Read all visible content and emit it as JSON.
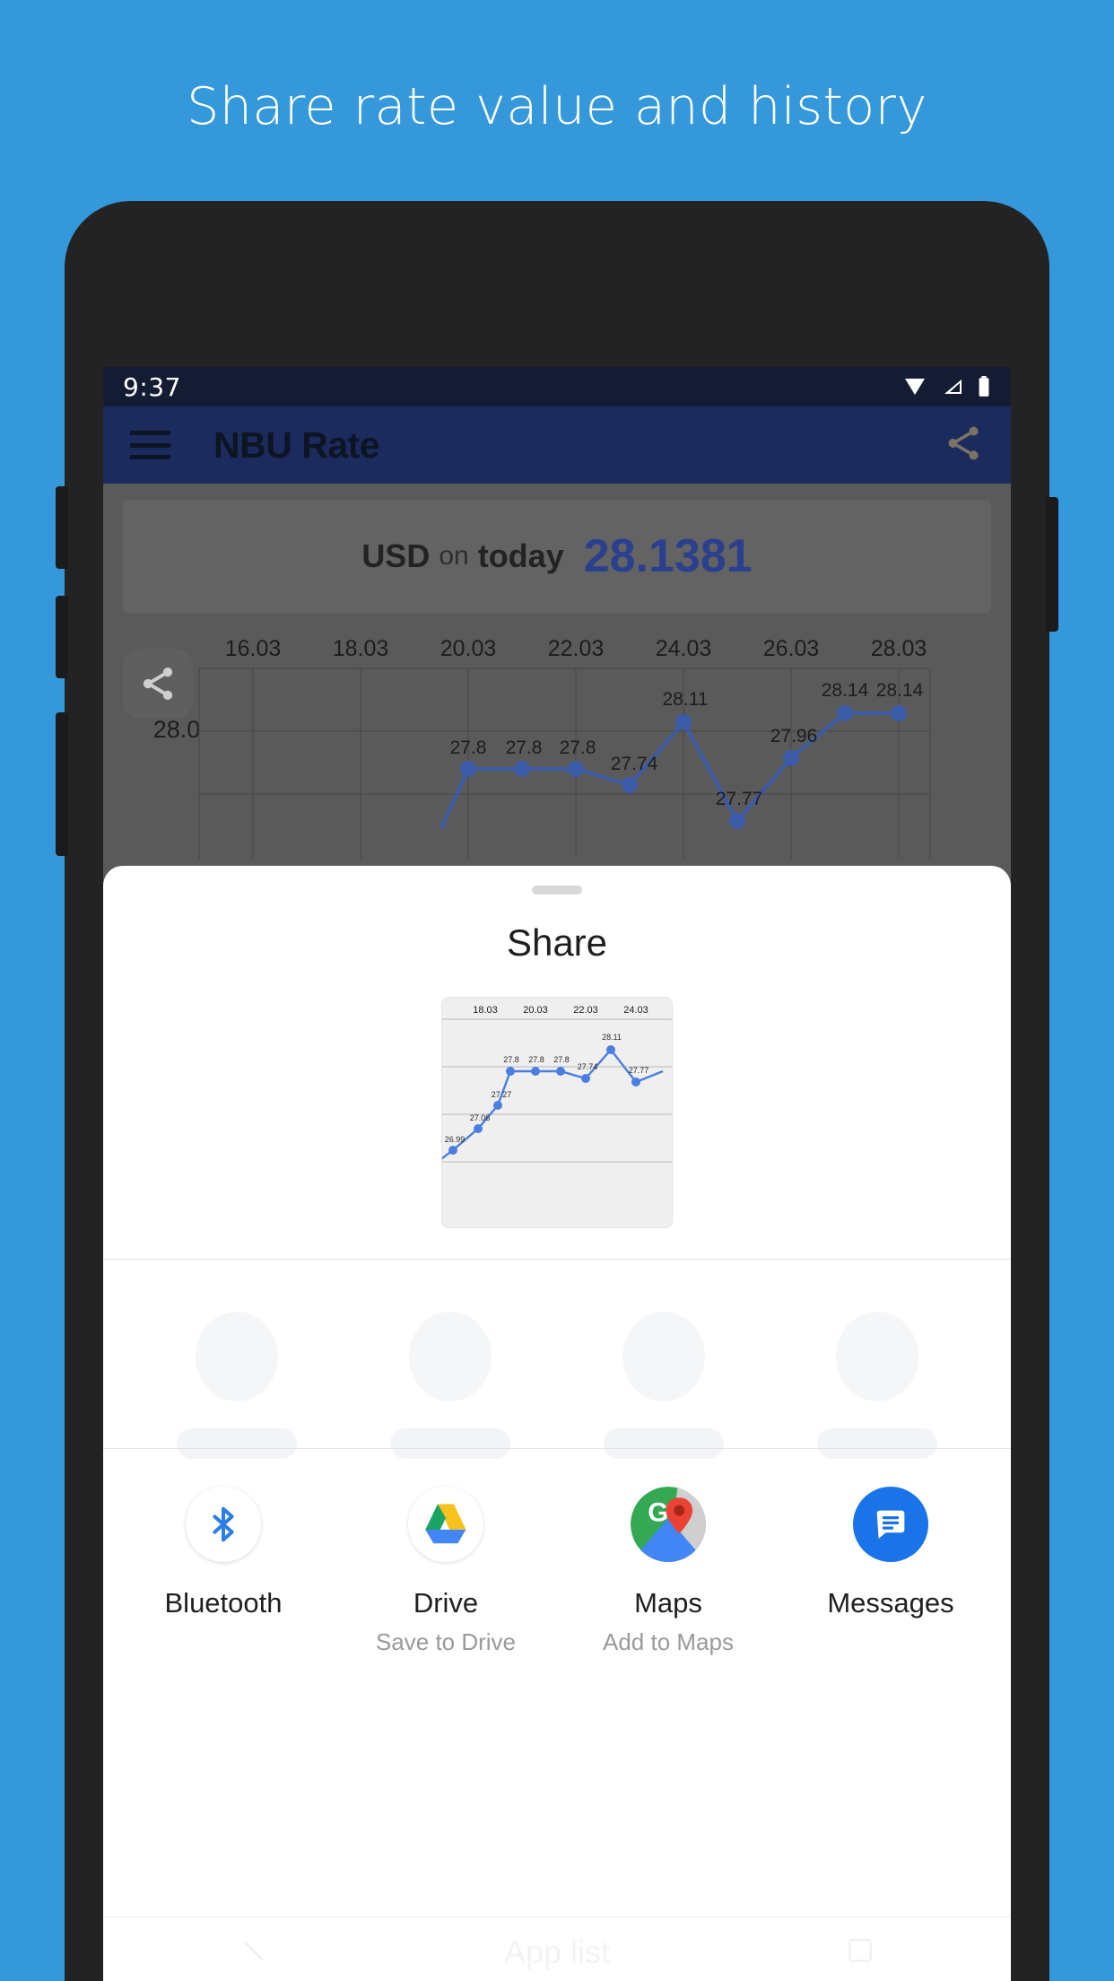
{
  "headline": "Share rate value and history",
  "colors": {
    "background": "#3498db",
    "phone_body": "#232323",
    "appbar": "#1c2b5e",
    "statusbar": "#141c33",
    "rate_value": "#2b3f8f",
    "chart_line": "#3b5ba9",
    "preview_line": "#4a7ee0"
  },
  "phone": {
    "statusbar": {
      "clock": "9:37",
      "icons": [
        "wifi-icon",
        "signal-icon",
        "battery-icon"
      ]
    },
    "appbar": {
      "menu_icon": "hamburger-menu-icon",
      "title": "NBU Rate",
      "share_icon": "share-icon"
    },
    "rate_card": {
      "currency": "USD",
      "connector": "on",
      "day": "today",
      "value": "28.1381"
    },
    "chart_fab": "share-fab-icon"
  },
  "chart_data": {
    "type": "line",
    "title": "",
    "xlabel": "",
    "ylabel": "",
    "x_tick_labels": [
      "16.03",
      "18.03",
      "20.03",
      "22.03",
      "24.03",
      "26.03",
      "28.03"
    ],
    "y_tick_labels": [
      "28.0"
    ],
    "ylim": [
      27.6,
      28.25
    ],
    "grid": true,
    "point_labels": [
      "27.8",
      "27.8",
      "27.8",
      "27.74",
      "28.11",
      "27.77",
      "27.96",
      "28.14",
      "28.14"
    ],
    "values": [
      27.8,
      27.8,
      27.8,
      27.74,
      28.11,
      27.77,
      27.96,
      28.14,
      28.14
    ],
    "legend": []
  },
  "preview_chart": {
    "type": "line",
    "x_tick_labels": [
      "18.03",
      "20.03",
      "22.03",
      "24.03"
    ],
    "point_labels": [
      "26.99",
      "27.06",
      "27.27",
      "27.8",
      "27.8",
      "27.8",
      "27.74",
      "28.11",
      "27.77"
    ],
    "values": [
      26.99,
      27.06,
      27.27,
      27.8,
      27.8,
      27.8,
      27.74,
      28.11,
      27.77
    ],
    "grid": true
  },
  "share_sheet": {
    "title": "Share",
    "grabber": "drag-handle",
    "apps": [
      {
        "name": "Bluetooth",
        "sub": "",
        "icon": "bluetooth-icon"
      },
      {
        "name": "Drive",
        "sub": "Save to Drive",
        "icon": "google-drive-icon"
      },
      {
        "name": "Maps",
        "sub": "Add to Maps",
        "icon": "google-maps-icon"
      },
      {
        "name": "Messages",
        "sub": "",
        "icon": "messages-icon"
      }
    ]
  },
  "navbar": {
    "back_icon": "back-icon",
    "watermark": "App list",
    "recents_icon": "recents-icon"
  }
}
